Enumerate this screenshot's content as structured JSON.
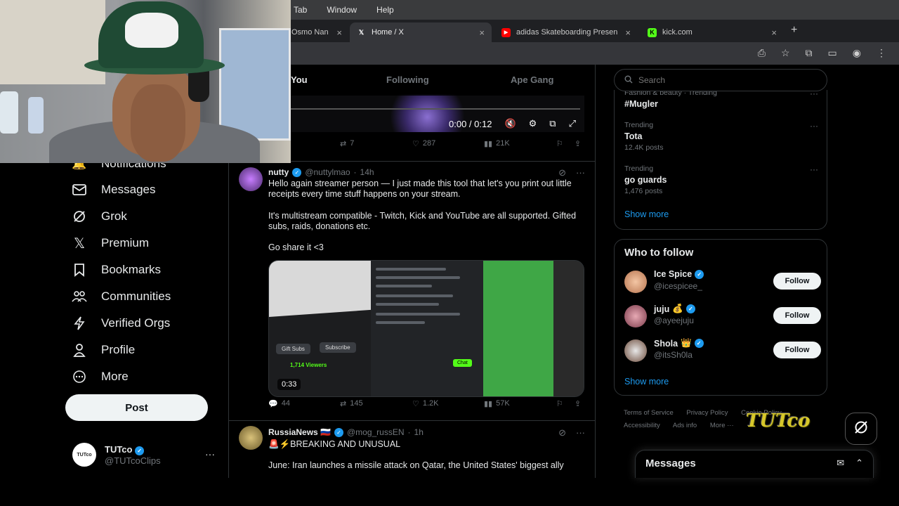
{
  "browser": {
    "menu": [
      "Tab",
      "Window",
      "Help"
    ],
    "tabs": [
      {
        "label": "Osmo Nan",
        "favicon": "generic"
      },
      {
        "label": "Home / X",
        "favicon": "x-logo"
      },
      {
        "label": "adidas Skateboarding Presen",
        "favicon": "youtube"
      },
      {
        "label": "kick.com",
        "favicon": "kick"
      }
    ],
    "new_tab": "+",
    "close": "×"
  },
  "nav": {
    "items": [
      {
        "label": "Notifications",
        "icon": "bell-icon"
      },
      {
        "label": "Messages",
        "icon": "envelope-icon"
      },
      {
        "label": "Grok",
        "icon": "grok-icon"
      },
      {
        "label": "Premium",
        "icon": "x-logo-icon"
      },
      {
        "label": "Bookmarks",
        "icon": "bookmark-icon"
      },
      {
        "label": "Communities",
        "icon": "people-icon"
      },
      {
        "label": "Verified Orgs",
        "icon": "lightning-icon"
      },
      {
        "label": "Profile",
        "icon": "person-icon"
      },
      {
        "label": "More",
        "icon": "more-circle-icon"
      }
    ],
    "post_label": "Post",
    "account": {
      "name": "TUTco",
      "handle": "@TUTcoClips",
      "avatar_text": "TUTco"
    }
  },
  "feed": {
    "tabs": [
      "You",
      "Following",
      "Ape Gang"
    ],
    "video_time": "0:00 / 0:12",
    "prev_actions": {
      "reposts": "7",
      "likes": "287",
      "views": "21K"
    },
    "tweet1": {
      "name": "nutty",
      "handle": "@nuttylmao",
      "time": "14h",
      "lines": [
        "Hello again streamer person — I just made this tool that let's you print out little receipts every time stuff happens on your stream.",
        "It's multistream compatible - Twitch, Kick and YouTube are all supported. Gifted subs, raids, donations etc.",
        "Go share it <3"
      ],
      "media_duration": "0:33",
      "media": {
        "gift_subs": "Gift Subs",
        "subscribe": "Subscribe",
        "viewers": "1,714 Viewers",
        "chat": "Chat"
      },
      "actions": {
        "replies": "44",
        "reposts": "145",
        "likes": "1.2K",
        "views": "57K"
      }
    },
    "tweet2": {
      "name": "RussiaNews 🇷🇺",
      "handle": "@mog_russEN",
      "time": "1h",
      "line1": "🚨⚡BREAKING AND UNUSUAL",
      "line2": "June: Iran launches a missile attack on Qatar, the United States' biggest ally"
    }
  },
  "right": {
    "search_placeholder": "Search",
    "trends": [
      {
        "context": "Fashion & beauty · Trending",
        "title": "#Mugler",
        "count": ""
      },
      {
        "context": "Trending",
        "title": "Tota",
        "count": "12.4K posts"
      },
      {
        "context": "Trending",
        "title": "go guards",
        "count": "1,476 posts"
      }
    ],
    "show_more": "Show more",
    "who_to_follow": {
      "title": "Who to follow",
      "users": [
        {
          "name": "Ice Spice",
          "emoji": "",
          "handle": "@icespicee_"
        },
        {
          "name": "juju",
          "emoji": "💰",
          "handle": "@ayeejuju"
        },
        {
          "name": "Shola",
          "emoji": "👑",
          "handle": "@itsSh0la"
        }
      ],
      "follow_label": "Follow"
    },
    "footer": [
      "Terms of Service",
      "Privacy Policy",
      "Cookie Policy",
      "Accessibility",
      "Ads info",
      "More ···"
    ],
    "messages_title": "Messages"
  },
  "watermark": "TUTco",
  "colors": {
    "accent": "#1d9bf0",
    "background": "#000000",
    "border": "#2f3336",
    "muted": "#71767b"
  }
}
